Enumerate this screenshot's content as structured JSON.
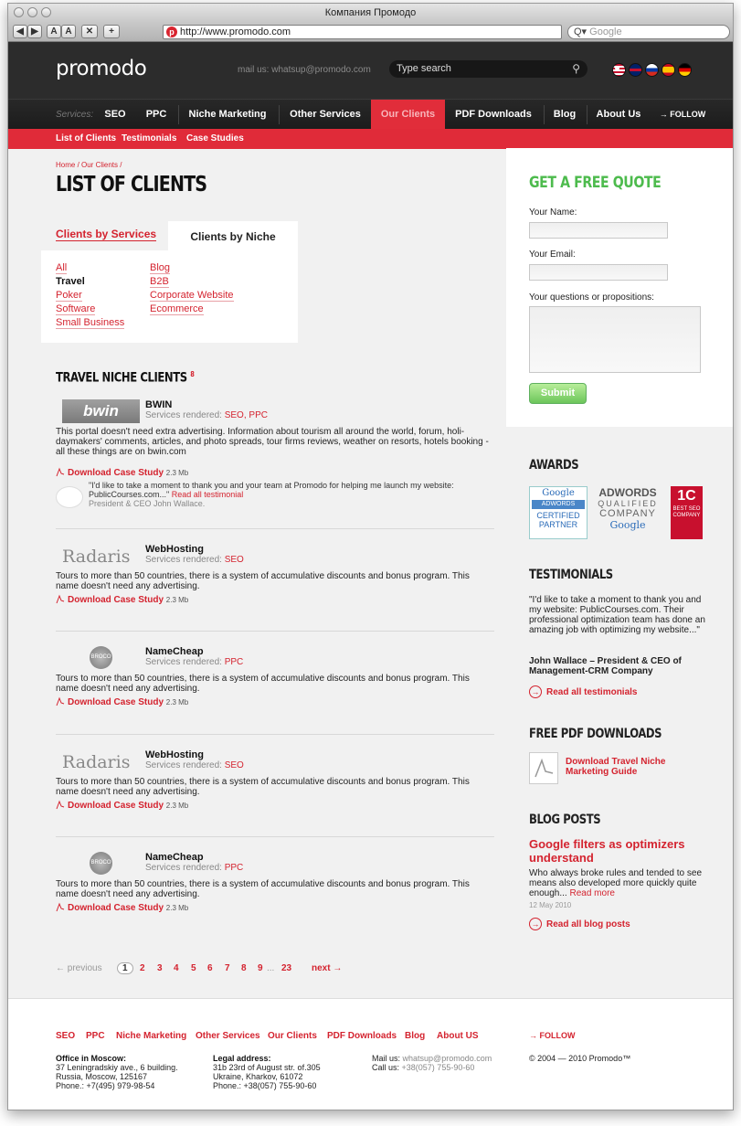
{
  "browser": {
    "title": "Компания Промодо",
    "nav_buttons": [
      "◀",
      "▶",
      "A",
      "A",
      "✕",
      "+"
    ],
    "url": "http://www.promodo.com",
    "search_placeholder": "Google",
    "search_prefix": "Q▾"
  },
  "header": {
    "logo": "promodo",
    "mail_label": "mail us:",
    "mail": "whatsup@promodo.com",
    "search_placeholder": "Type search",
    "flags": [
      {
        "name": "us-flag",
        "color": "#3a4f8f"
      },
      {
        "name": "uk-flag",
        "color": "#c8102e"
      },
      {
        "name": "ru-flag",
        "color": "#e8e8f0"
      },
      {
        "name": "es-flag",
        "color": "#f1bf00"
      },
      {
        "name": "de-flag",
        "color": "#dd0000"
      }
    ]
  },
  "nav": {
    "label": "Services:",
    "items": [
      "SEO",
      "PPC",
      "Niche Marketing",
      "Other Services",
      "Our Clients",
      "PDF Downloads",
      "Blog",
      "About Us"
    ],
    "active": "Our Clients",
    "follow": "→ FOLLOW"
  },
  "subnav": [
    "List of Clients",
    "Testimonials",
    "Case Studies"
  ],
  "page": {
    "breadcrumb": "Home / Our Clients /",
    "title": "LIST OF CLIENTS",
    "tabs": [
      "Clients by Services",
      "Clients by Niche"
    ],
    "niches_left": [
      "All",
      "Travel",
      "Poker",
      "Software",
      "Small Business"
    ],
    "niches_right": [
      "Blog",
      "B2B",
      "Corporate Website",
      "Ecommerce"
    ],
    "current_niche": "Travel",
    "section_title": "TRAVEL NICHE CLIENTS",
    "section_count": "8"
  },
  "clients": [
    {
      "name": "BWIN",
      "logo_text": "bwin",
      "services_label": "Services rendered:",
      "services": "SEO, PPC",
      "description": "This portal doesn't need extra advertising. Information about tourism all around the world, forum, holi-daymakers' comments, articles, and photo spreads, tour firms reviews, weather on resorts, hotels booking - all these things are on bwin.com",
      "download": "Download Case Study",
      "size": "2.3 Mb",
      "testimonial": "\"I'd like to take a moment to thank you and your team at Promodo for helping me launch my website: PublicCourses.com...\"",
      "testimonial_link": "Read all testimonial",
      "testimonial_author": "President & CEO John Wallace."
    },
    {
      "name": "WebHosting",
      "logo_text": "Radaris",
      "services_label": "Services rendered:",
      "services": "SEO",
      "description": "Tours to more than 50 countries, there is a system of accumulative discounts and bonus program. This name doesn't need any advertising.",
      "download": "Download Case Study",
      "size": "2.3 Mb"
    },
    {
      "name": "NameCheap",
      "logo_text": "BROCO",
      "services_label": "Services rendered:",
      "services": "PPC",
      "description": "Tours to more than 50 countries, there is a system of accumulative discounts and bonus program. This name doesn't need any advertising.",
      "download": "Download Case Study",
      "size": "2.3 Mb"
    },
    {
      "name": "WebHosting",
      "logo_text": "Radaris",
      "services_label": "Services rendered:",
      "services": "SEO",
      "description": "Tours to more than 50 countries, there is a system of accumulative discounts and bonus program. This name doesn't need any advertising.",
      "download": "Download Case Study",
      "size": "2.3 Mb"
    },
    {
      "name": "NameCheap",
      "logo_text": "BROCO",
      "services_label": "Services rendered:",
      "services": "PPC",
      "description": "Tours to more than 50 countries, there is a system of accumulative discounts and bonus program. This name doesn't need any advertising.",
      "download": "Download Case Study",
      "size": "2.3 Mb"
    }
  ],
  "pager": {
    "previous": "← previous",
    "current": "1",
    "pages": [
      "2",
      "3",
      "4",
      "5",
      "6",
      "7",
      "8",
      "9"
    ],
    "ellipsis": "...",
    "last": "23",
    "next": "next →"
  },
  "sidebar": {
    "quote_title": "GET A FREE QUOTE",
    "name_label": "Your Name:",
    "email_label": "Your Email:",
    "questions_label": "Your questions or propositions:",
    "submit": "Submit",
    "awards_title": "AWARDS",
    "award1": {
      "top": "Google",
      "mid": "ADWORDS",
      "bottom1": "CERTIFIED",
      "bottom2": "PARTNER"
    },
    "award2": {
      "l1": "ADWORDS",
      "l2": "QUALIFIED",
      "l3": "COMPANY",
      "l4": "Google"
    },
    "award3": {
      "l1": "1C",
      "l2": "BEST SEO",
      "l3": "COMPANY"
    },
    "testimonials_title": "TESTIMONIALS",
    "testimonial_text": "\"I'd like to take a moment to thank you and my website: PublicCourses.com. Their professional optimization team has done an amazing job with optimizing my website...\"",
    "testimonial_author": "John Wallace – President & CEO of Management-CRM Company",
    "read_testimonials": "Read all testimonials",
    "pdf_title": "FREE PDF DOWNLOADS",
    "pdf_link": "Download Travel Niche Marketing Guide",
    "blog_title": "BLOG POSTS",
    "blog_post_title": "Google filters as optimizers understand",
    "blog_excerpt": "Who always broke rules and tended to see means also developed more quickly quite enough...",
    "blog_read_more": "Read more",
    "blog_date": "12 May 2010",
    "read_blog": "Read all blog posts"
  },
  "footer": {
    "nav": [
      "SEO",
      "PPC",
      "Niche Marketing",
      "Other Services",
      "Our Clients",
      "PDF Downloads",
      "Blog",
      "About US"
    ],
    "follow": "→ FOLLOW",
    "moscow_title": "Office in Moscow:",
    "moscow_lines": [
      "37 Leningradskiy ave., 6 building.",
      "Russia, Moscow, 125167",
      "Phone.: +7(495) 979-98-54"
    ],
    "legal_title": "Legal address:",
    "legal_lines": [
      "31b 23rd of August str. of.305",
      "Ukraine, Kharkov, 61072",
      "Phone.: +38(057) 755-90-60"
    ],
    "mail_label": "Mail us:",
    "mail": "whatsup@promodo.com",
    "call_label": "Call us:",
    "call": "+38(057) 755-90-60",
    "copyright": "© 2004 — 2010 Promodo™"
  },
  "colors": {
    "accent": "#e02b39",
    "green": "#4dbb4d",
    "dark": "#2c2c2c"
  }
}
